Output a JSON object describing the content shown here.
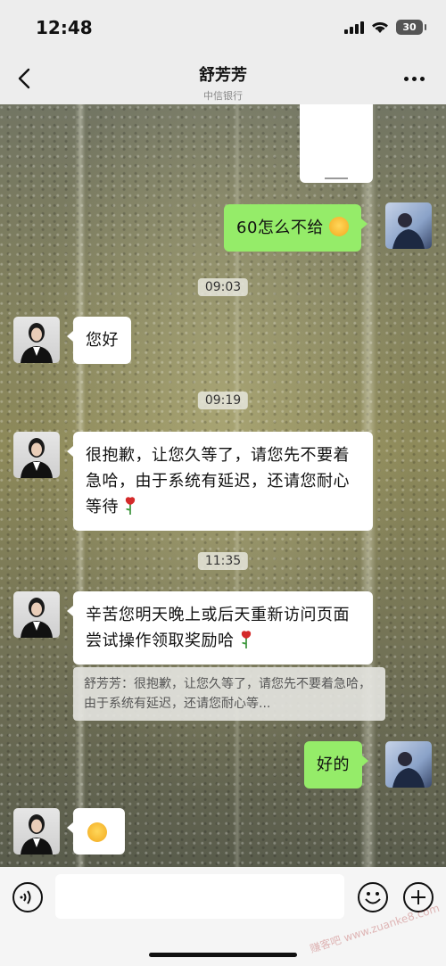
{
  "status_bar": {
    "time": "12:48",
    "battery": "30"
  },
  "header": {
    "title": "舒芳芳",
    "subtitle": "中信银行"
  },
  "messages": {
    "m1": "60怎么不给",
    "ts1": "09:03",
    "m2": "您好",
    "ts2": "09:19",
    "m3": "很抱歉，让您久等了，请您先不要着急哈，由于系统有延迟，还请您耐心等待",
    "ts3": "11:35",
    "m4": "辛苦您明天晚上或后天重新访问页面尝试操作领取奖励哈",
    "quote": "舒芳芳：很抱歉，让您久等了，请您先不要着急哈，由于系统有延迟，还请您耐心等...",
    "m5": "好的"
  },
  "input": {
    "placeholder": ""
  },
  "watermark": "赚客吧 www.zuanke8.com",
  "icons": [
    "back-arrow-icon",
    "more-dots-icon",
    "voice-icon",
    "emoji-icon",
    "plus-icon",
    "smile-emoji-icon",
    "rose-emoji-icon"
  ],
  "colors": {
    "sent_bubble": "#95ec69",
    "received_bubble": "#ffffff",
    "header_bg": "#ededed"
  }
}
